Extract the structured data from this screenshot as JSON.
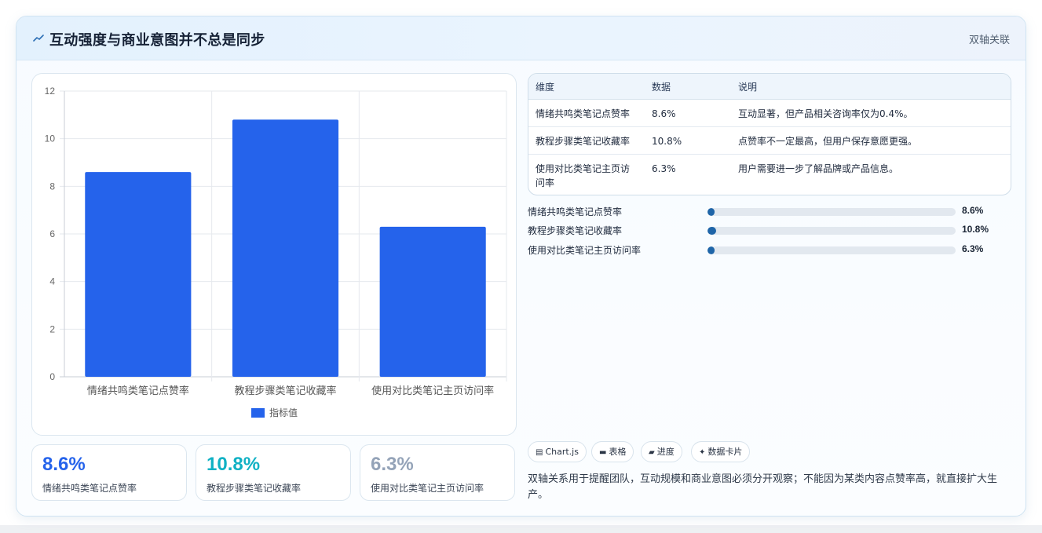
{
  "header": {
    "icon": "trend-line-icon",
    "title": "互动强度与商业意图并不总是同步",
    "tag": "双轴关联"
  },
  "chart_data": {
    "type": "bar",
    "categories": [
      "情绪共鸣类笔记点赞率",
      "教程步骤类笔记收藏率",
      "使用对比类笔记主页访问率"
    ],
    "series": [
      {
        "name": "指标值",
        "values": [
          8.6,
          10.8,
          6.3
        ],
        "color": "#2563eb"
      }
    ],
    "ylim": [
      0,
      12
    ],
    "yticks": [
      0,
      2,
      4,
      6,
      8,
      10,
      12
    ],
    "grid": true,
    "legend": "bottom"
  },
  "stats": [
    {
      "value": "8.6%",
      "label": "情绪共鸣类笔记点赞率",
      "color": "#2563eb"
    },
    {
      "value": "10.8%",
      "label": "教程步骤类笔记收藏率",
      "color": "#10b1c4"
    },
    {
      "value": "6.3%",
      "label": "使用对比类笔记主页访问率",
      "color": "#94a3b8"
    }
  ],
  "table": {
    "headers": [
      "维度",
      "数据",
      "说明"
    ],
    "rows": [
      {
        "dim": "情绪共鸣类笔记点赞率",
        "data": "8.6%",
        "desc": "互动显著，但产品相关咨询率仅为0.4%。"
      },
      {
        "dim": "教程步骤类笔记收藏率",
        "data": "10.8%",
        "desc": "点赞率不一定最高，但用户保存意愿更强。"
      },
      {
        "dim": "使用对比类笔记主页访问率",
        "data": "6.3%",
        "desc": "用户需要进一步了解品牌或产品信息。"
      }
    ]
  },
  "progress": [
    {
      "label": "情绪共鸣类笔记点赞率",
      "value": "8.6%",
      "fill_fraction": 0.028
    },
    {
      "label": "教程步骤类笔记收藏率",
      "value": "10.8%",
      "fill_fraction": 0.036
    },
    {
      "label": "使用对比类笔记主页访问率",
      "value": "6.3%",
      "fill_fraction": 0.028
    }
  ],
  "chips": [
    {
      "icon": "chart-icon",
      "glyph": "▤",
      "label": "Chart.js"
    },
    {
      "icon": "table-icon",
      "glyph": "▬",
      "label": "表格"
    },
    {
      "icon": "progress-icon",
      "glyph": "▰",
      "label": "进度"
    },
    {
      "icon": "sparkle-icon",
      "glyph": "✦",
      "label": "数据卡片"
    }
  ],
  "note": "双轴关系用于提醒团队，互动规模和商业意图必须分开观察；不能因为某类内容点赞率高，就直接扩大生产。"
}
